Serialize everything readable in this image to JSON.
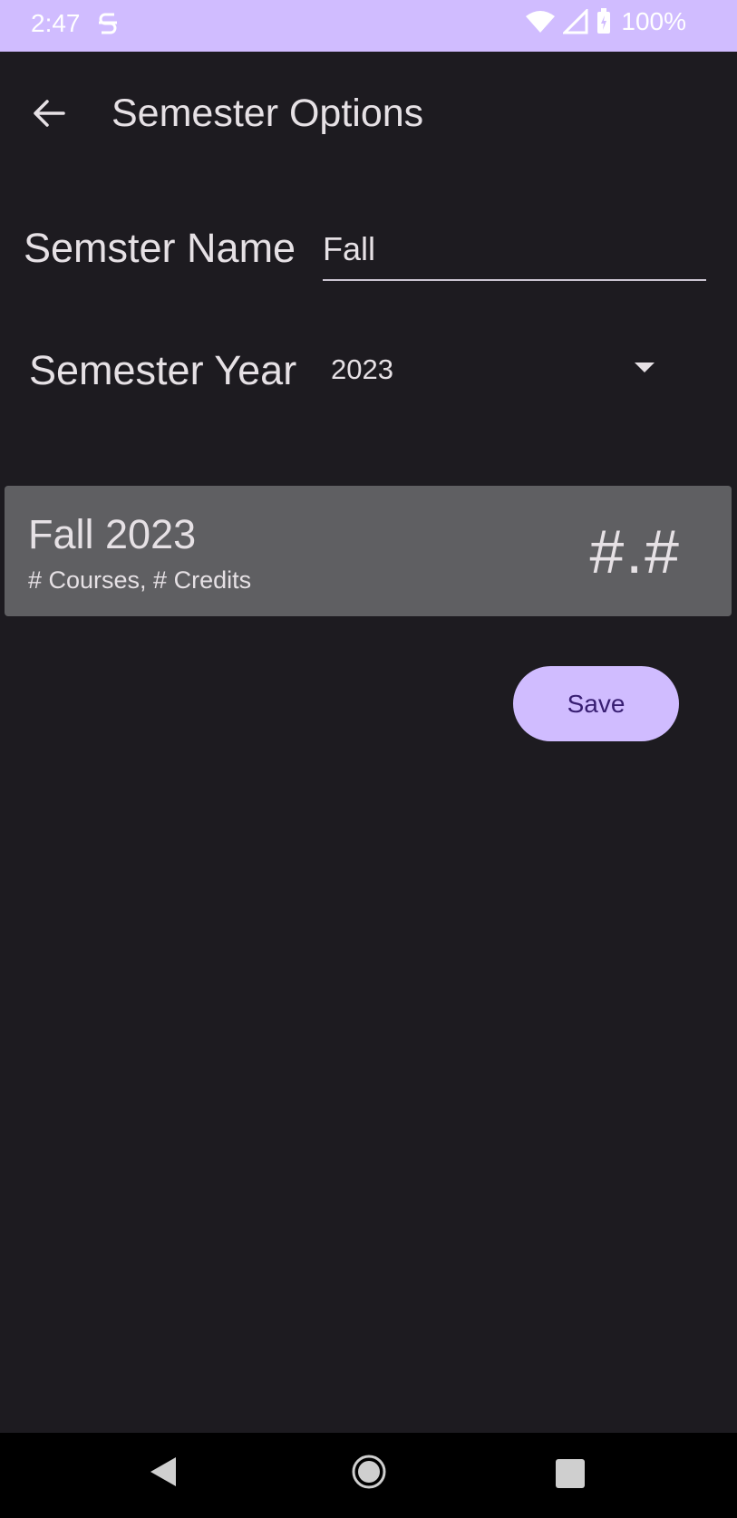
{
  "status_bar": {
    "time": "2:47",
    "battery": "100%",
    "icons": [
      "sync-icon",
      "wifi-icon",
      "signal-icon",
      "battery-icon"
    ]
  },
  "app_bar": {
    "title": "Semester Options",
    "back_icon": "arrow-back-icon"
  },
  "form": {
    "name_label": "Semster Name",
    "name_value": "Fall",
    "year_label": "Semester Year",
    "year_value": "2023"
  },
  "preview_card": {
    "title": "Fall 2023",
    "subtitle": "# Courses, # Credits",
    "gpa": "#.#"
  },
  "actions": {
    "save_label": "Save"
  },
  "colors": {
    "background": "#1d1b20",
    "accent": "#d0bcff",
    "card": "#5f5f62",
    "on_accent": "#381e72"
  }
}
